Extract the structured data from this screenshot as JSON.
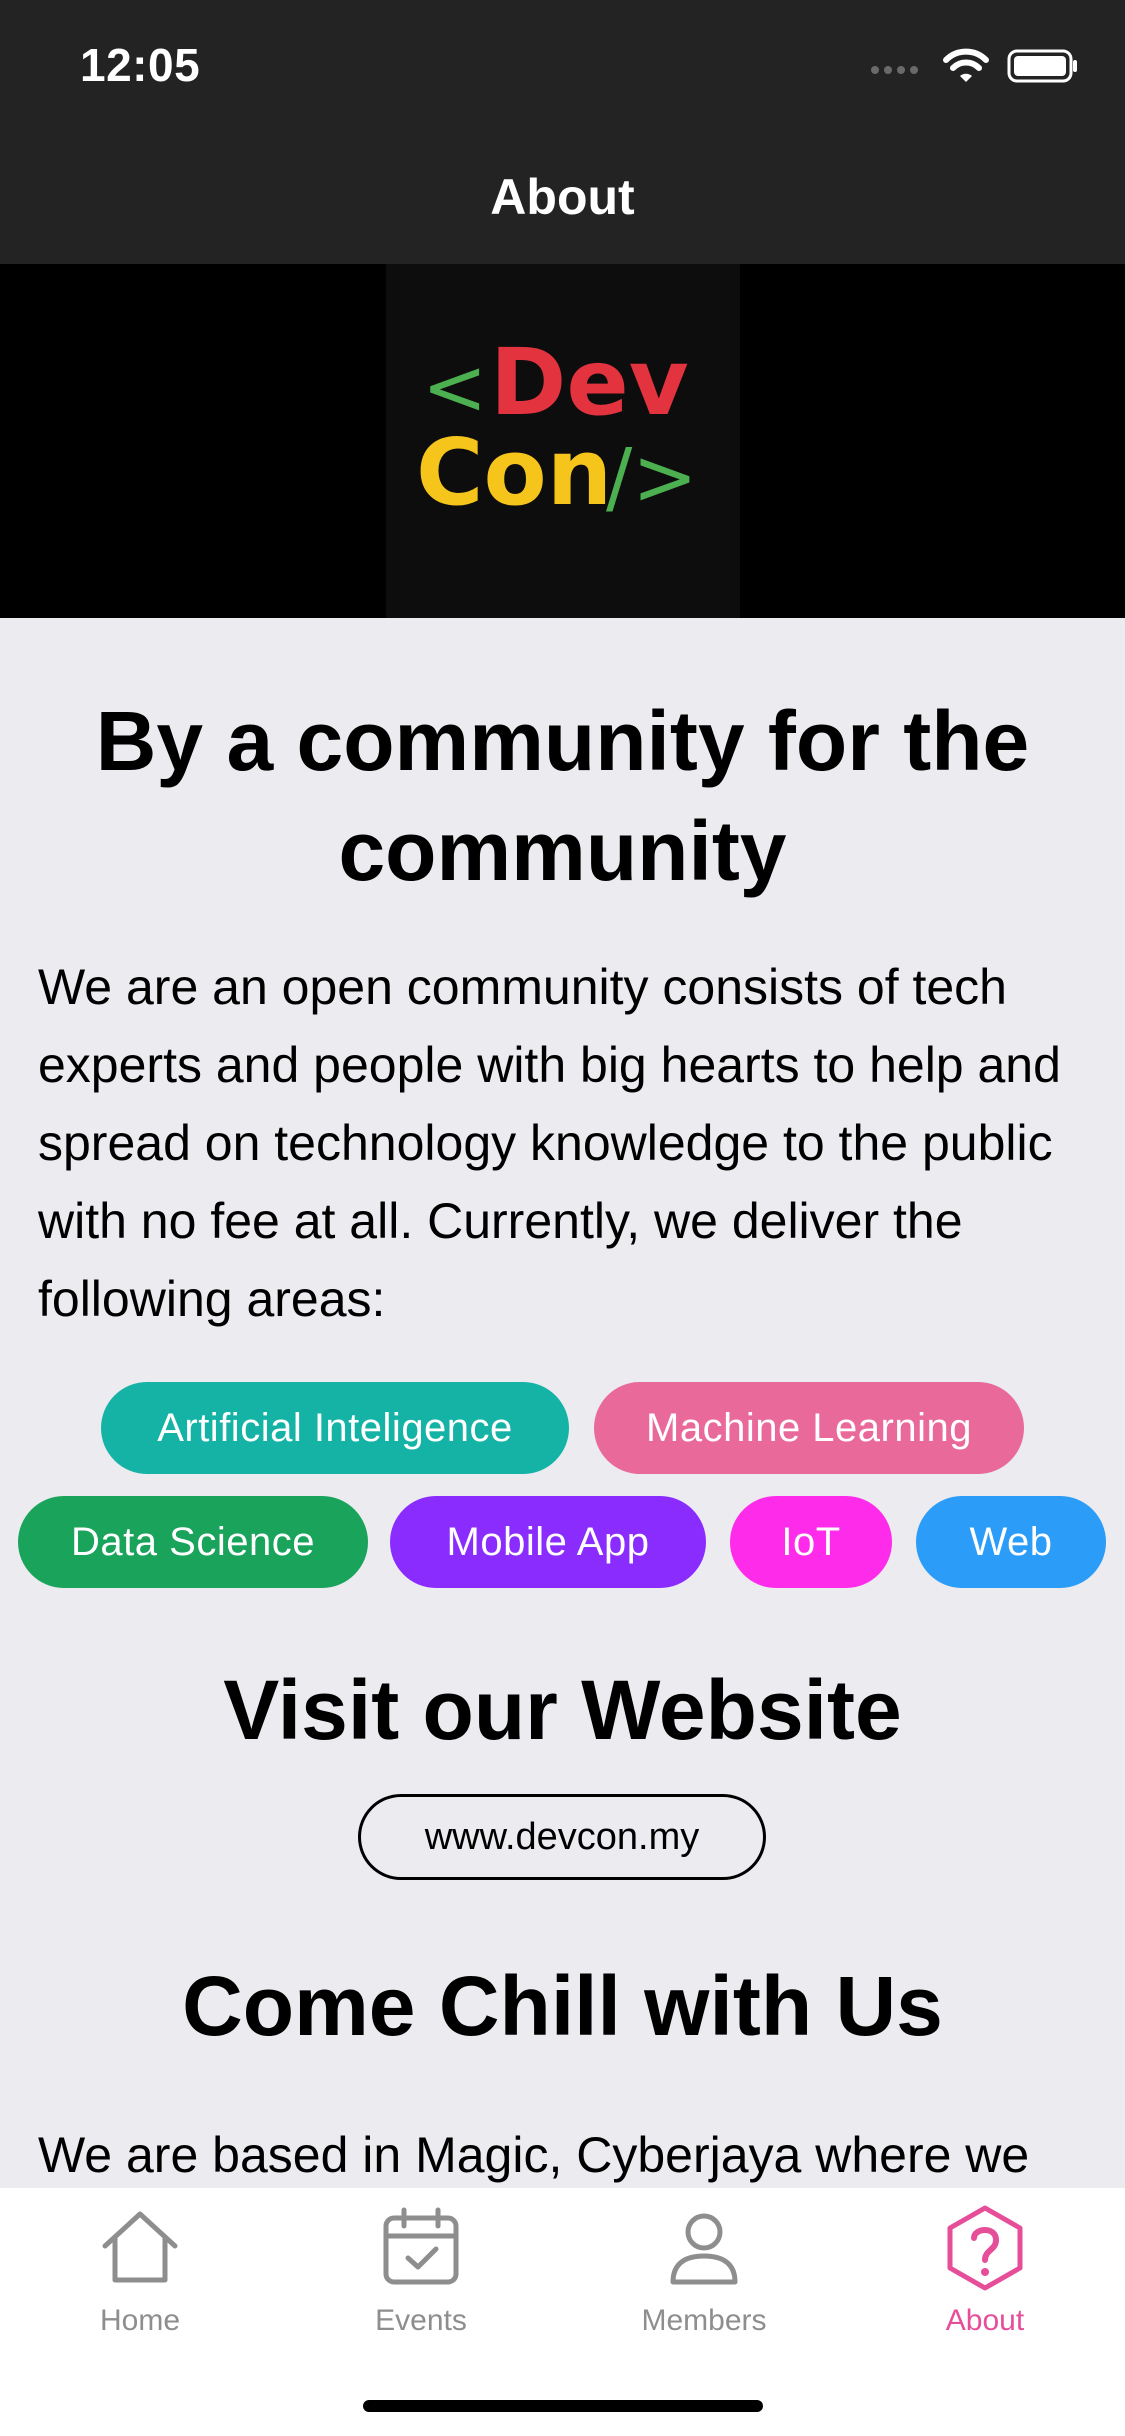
{
  "status_bar": {
    "time": "12:05"
  },
  "nav": {
    "title": "About"
  },
  "hero": {
    "logo_line1_symbol": "<",
    "logo_line1_word": "Dev",
    "logo_line2_word": "Con",
    "logo_line2_symbol": "/>"
  },
  "headline": "By a community for the community",
  "intro": "We are an open community consists of tech experts and people with big hearts to help and spread on technology knowledge to the public with no fee at all. Currently, we deliver the following areas:",
  "areas": [
    {
      "label": "Artificial Inteligence",
      "color": "#14b3a6"
    },
    {
      "label": "Machine Learning",
      "color": "#e8699a"
    },
    {
      "label": "Data Science",
      "color": "#1aa35b"
    },
    {
      "label": "Mobile App",
      "color": "#8b2cff"
    },
    {
      "label": "IoT",
      "color": "#ff2bea"
    },
    {
      "label": "Web",
      "color": "#2b9cf7"
    }
  ],
  "website_section": {
    "title": "Visit our Website",
    "url": "www.devcon.my"
  },
  "chill_section": {
    "title": "Come Chill with Us",
    "text": "We are based in Magic, Cyberjaya where we"
  },
  "tabbar": {
    "items": [
      {
        "label": "Home",
        "icon": "home-icon",
        "active": false
      },
      {
        "label": "Events",
        "icon": "calendar-icon",
        "active": false
      },
      {
        "label": "Members",
        "icon": "person-icon",
        "active": false
      },
      {
        "label": "About",
        "icon": "question-hexagon-icon",
        "active": true
      }
    ],
    "active_color": "#e64e9a",
    "inactive_color": "#8e8e8e"
  },
  "colors": {
    "nav_bg": "#232323",
    "content_bg": "#ebebf0",
    "logo_red": "#e2333f",
    "logo_blue": "#27b3e0",
    "logo_yellow": "#f6c51b",
    "logo_orange": "#ee5a24",
    "logo_green": "#4caf50"
  }
}
